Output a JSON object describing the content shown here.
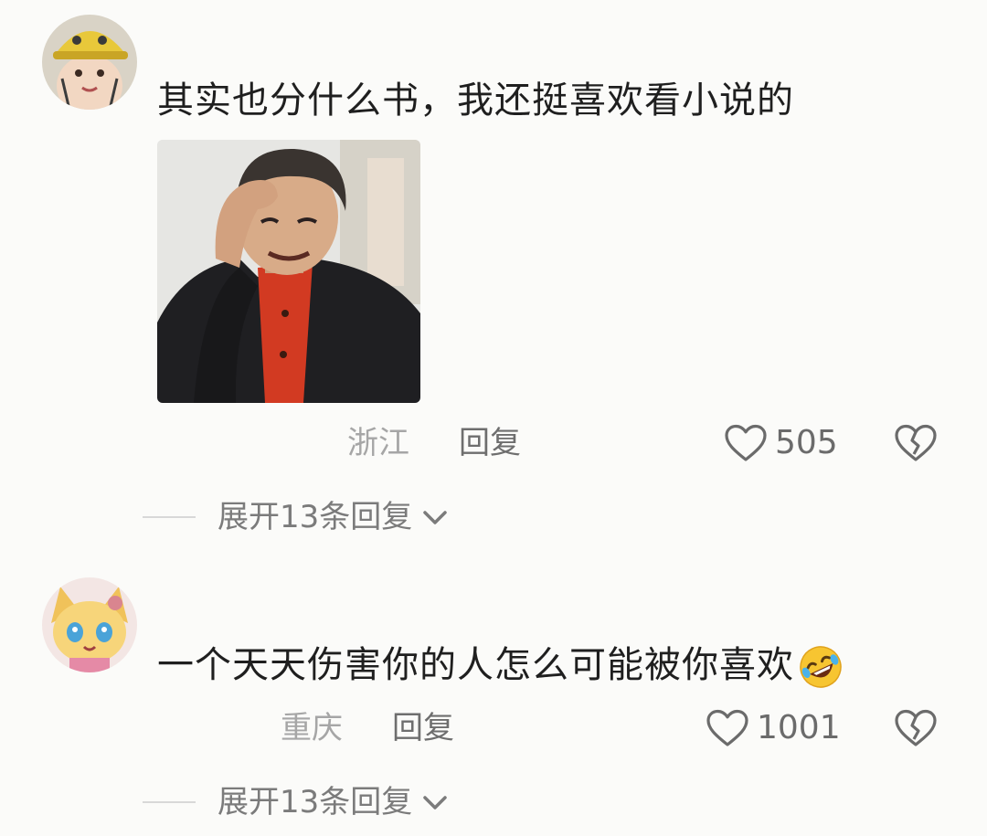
{
  "comments": [
    {
      "text": "其实也分什么书，我还挺喜欢看小说的",
      "location": "浙江",
      "reply_label": "回复",
      "like_count": "505",
      "expand_label": "展开13条回复"
    },
    {
      "text": "一个天天伤害你的人怎么可能被你喜欢",
      "location": "重庆",
      "reply_label": "回复",
      "like_count": "1001",
      "expand_label": "展开13条回复"
    }
  ],
  "icons": {
    "like": "heart-outline-icon",
    "dislike": "broken-heart-icon",
    "expand": "chevron-down-icon",
    "emoji": "rofl-emoji-icon"
  },
  "colors": {
    "background": "#fbfbf9",
    "text": "#1f1f1f",
    "secondary": "#6e6e6e",
    "muted": "#a6a6a6"
  }
}
